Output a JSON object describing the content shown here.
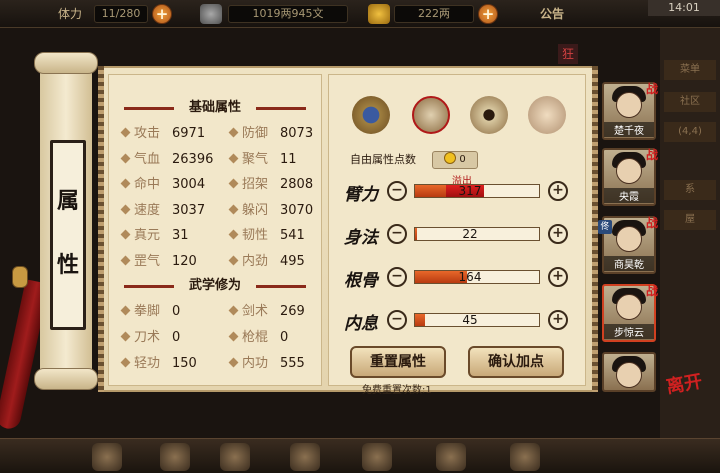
{
  "topbar": {
    "stamina_label": "体力",
    "stamina_value": "11/280",
    "money_value": "1019两945文",
    "gold_value": "222两",
    "announcement": "公告",
    "time": "14:01"
  },
  "scroll": {
    "title_chars": [
      "属",
      "性"
    ]
  },
  "side_tags": [
    "菜单",
    "社区",
    "(4,4)",
    "系",
    "屋"
  ],
  "kuang": "狂",
  "basic_attrs": {
    "title": "基础属性",
    "items": [
      {
        "label": "攻击",
        "value": "6971"
      },
      {
        "label": "防御",
        "value": "8073"
      },
      {
        "label": "气血",
        "value": "26396"
      },
      {
        "label": "聚气",
        "value": "11"
      },
      {
        "label": "命中",
        "value": "3004"
      },
      {
        "label": "招架",
        "value": "2808"
      },
      {
        "label": "速度",
        "value": "3037"
      },
      {
        "label": "躲闪",
        "value": "3070"
      },
      {
        "label": "真元",
        "value": "31"
      },
      {
        "label": "韧性",
        "value": "541"
      },
      {
        "label": "罡气",
        "value": "120"
      },
      {
        "label": "内劲",
        "value": "495"
      }
    ]
  },
  "martial": {
    "title": "武学修为",
    "items": [
      {
        "label": "拳脚",
        "value": "0"
      },
      {
        "label": "剑术",
        "value": "269"
      },
      {
        "label": "刀术",
        "value": "0"
      },
      {
        "label": "枪棍",
        "value": "0"
      },
      {
        "label": "轻功",
        "value": "150"
      },
      {
        "label": "内功",
        "value": "555"
      }
    ]
  },
  "points": {
    "free_label": "自由属性点数",
    "free_value": "0",
    "overflow_label": "溢出",
    "attributes": [
      {
        "name": "臂力",
        "value": "317",
        "fill": 0.55,
        "overflow": 0.55
      },
      {
        "name": "身法",
        "value": "22",
        "fill": 0.02,
        "overflow": 0
      },
      {
        "name": "根骨",
        "value": "164",
        "fill": 0.42,
        "overflow": 0
      },
      {
        "name": "内息",
        "value": "45",
        "fill": 0.08,
        "overflow": 0
      }
    ],
    "minus_symbol": "−",
    "plus_symbol": "+"
  },
  "buttons": {
    "reset": "重置属性",
    "confirm": "确认加点",
    "reset_free": "免费重置次数:1"
  },
  "characters": [
    {
      "name": "楚千夜",
      "tag": "战"
    },
    {
      "name": "央霞",
      "tag": "战"
    },
    {
      "name": "商昊乾",
      "tag": "战"
    },
    {
      "name": "步惊云",
      "tag": "战"
    },
    {
      "name": "",
      "tag": ""
    }
  ],
  "leave_label": "离开",
  "extra_badge": "佟"
}
